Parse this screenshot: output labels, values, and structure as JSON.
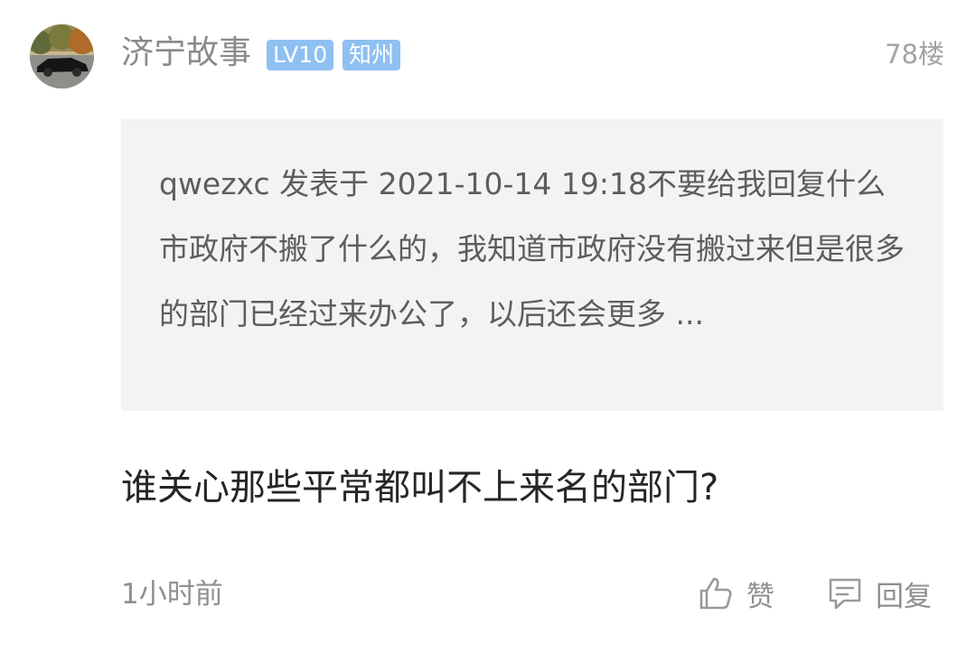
{
  "post": {
    "username": "济宁故事",
    "level_badge": "LV10",
    "location_badge": "知州",
    "floor": "78楼",
    "quote_text": "qwezxc 发表于 2021-10-14 19:18不要给我回复什么市政府不搬了什么的，我知道市政府没有搬过来但是很多的部门已经过来办公了，以后还会更多 ...",
    "reply_text": "谁关心那些平常都叫不上来名的部门?",
    "time": "1小时前",
    "actions": {
      "like_label": "赞",
      "reply_label": "回复"
    }
  },
  "icons": {
    "like": "thumbs-up-icon",
    "reply": "comment-icon"
  },
  "colors": {
    "badge": "#8fc0f2",
    "quote_background": "#f3f3f3",
    "muted_text": "#8a8a8a",
    "body_text": "#262626"
  }
}
